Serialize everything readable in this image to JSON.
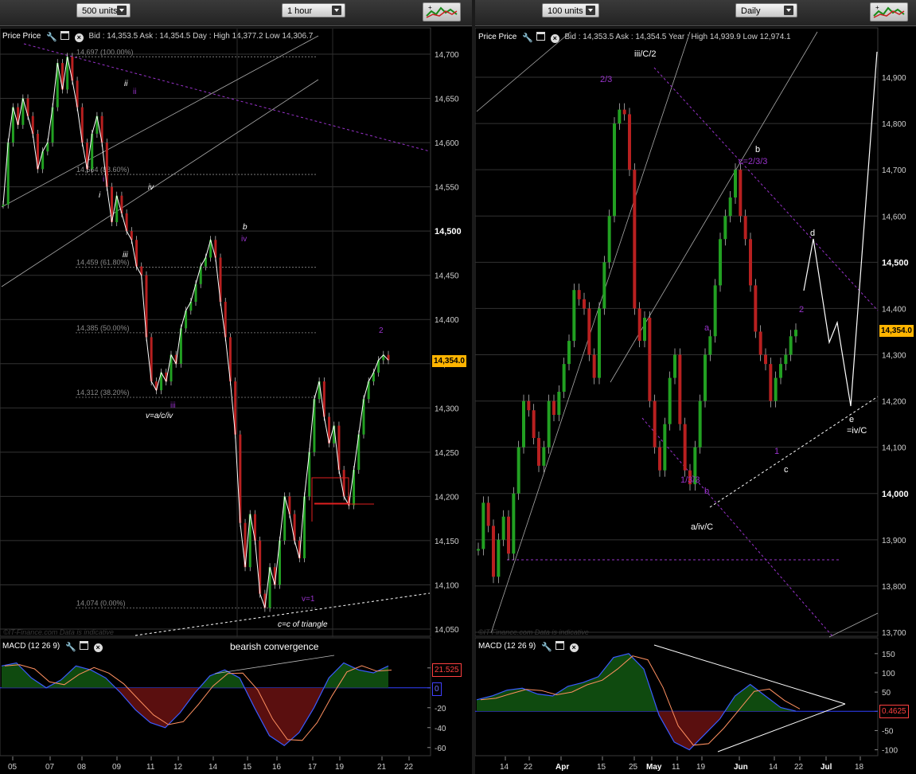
{
  "left": {
    "units_label": "500 units",
    "interval_label": "1 hour",
    "header": {
      "name": "Price Price",
      "quote": "Bid : 14,353.5  Ask : 14,354.5  Day : High 14,377.2  Low 14,306.7"
    },
    "price_tag": "14,354.0",
    "y_ticks": [
      "14,700",
      "14,650",
      "14,600",
      "14,550",
      "14,500",
      "14,450",
      "14,400",
      "14,350",
      "14,300",
      "14,250",
      "14,200",
      "14,150",
      "14,100",
      "14,050"
    ],
    "x_ticks": [
      "05",
      "07",
      "08",
      "09",
      "11",
      "12",
      "14",
      "15",
      "16",
      "17",
      "19",
      "21",
      "22"
    ],
    "fib_levels": [
      "14,697 (100.00%)",
      "14,564 (88.60%)",
      "14,459 (61.80%)",
      "14,385 (50.00%)",
      "14,312 (38.20%)",
      "14,074 (0.00%)"
    ],
    "wave_labels": {
      "ii_w": "ii",
      "ii_p": "ii",
      "i_p": "i",
      "i_w": "i",
      "iv_w": "iv",
      "iii_w": "iii",
      "iii_p": "iii",
      "v_acfv": "v=a/c/iv",
      "b": "b",
      "iv_p": "iv",
      "two": "2",
      "v1": "v=1",
      "c_tri": "c=c of triangle"
    },
    "watermark": "©IT-Finance.com  Data is indicative",
    "macd": {
      "title": "MACD (12 26 9)",
      "annotation": "bearish convergence",
      "value": "21.525",
      "zero_tag": "0",
      "ticks": [
        "20",
        "0",
        "-20",
        "-40",
        "-60"
      ]
    },
    "bold_tick": "14,500"
  },
  "right": {
    "units_label": "100 units",
    "interval_label": "Daily",
    "header": {
      "name": "Price Price",
      "quote": "Bid : 14,353.5  Ask : 14,354.5  Year : High 14,939.9  Low 12,974.1"
    },
    "price_tag": "14,354.0",
    "y_ticks": [
      "14,900",
      "14,800",
      "14,700",
      "14,600",
      "14,500",
      "14,400",
      "14,300",
      "14,200",
      "14,100",
      "14,000",
      "13,900",
      "13,800",
      "13,700"
    ],
    "x_ticks": [
      "14",
      "22",
      "Apr",
      "15",
      "25",
      "May",
      "11",
      "19",
      "Jun",
      "14",
      "22",
      "Jul",
      "18"
    ],
    "wave_labels": {
      "iiiC2": "iii/C/2",
      "two3": "2/3",
      "b": "b",
      "c23": "c=2/3/3",
      "a": "a",
      "one33": "1/3/3",
      "b2": "b",
      "aivC": "a/iv/C",
      "d": "d",
      "two": "2",
      "one": "1",
      "c": "c",
      "e": "e",
      "ivC": "=iv/C"
    },
    "watermark": "©IT-Finance.com  Data is indicative",
    "macd": {
      "title": "MACD (12 26 9)",
      "value": "0.4625",
      "ticks": [
        "150",
        "100",
        "50",
        "0",
        "-50",
        "-100"
      ]
    }
  },
  "colors": {
    "up": "#22a022",
    "down": "#b82020",
    "fib": "#8a8a8a",
    "purple": "#9933cc",
    "grid": "#333333",
    "macd_pos": "#0f4a0f",
    "macd_neg": "#5a0f0f",
    "price_tag": "#ffb400"
  },
  "chart_data": [
    {
      "type": "line",
      "title": "Price Price",
      "interval": "1 hour",
      "x_ticks": [
        "05",
        "07",
        "08",
        "09",
        "11",
        "12",
        "14",
        "15",
        "16",
        "17",
        "19",
        "21",
        "22"
      ],
      "ylim": [
        14050,
        14700
      ],
      "x": [
        0,
        1,
        2,
        3,
        4,
        5,
        6,
        7,
        8,
        9,
        10,
        11,
        12,
        13,
        14,
        15,
        16,
        17,
        18,
        19,
        20,
        21,
        22,
        23,
        24,
        25,
        26,
        27,
        28,
        29,
        30,
        31,
        32,
        33,
        34,
        35,
        36,
        37,
        38,
        39,
        40,
        41,
        42,
        43,
        44,
        45,
        46,
        47,
        48,
        49,
        50,
        51,
        52,
        53,
        54,
        55,
        56,
        57,
        58,
        59,
        60,
        61,
        62,
        63,
        64,
        65,
        66,
        67,
        68,
        69,
        70,
        71,
        72,
        73,
        74,
        75,
        76,
        77,
        78,
        79,
        80,
        81,
        82,
        83,
        84,
        85,
        86,
        87,
        88
      ],
      "series": [
        {
          "values": [
            14530,
            14600,
            14640,
            14620,
            14650,
            14630,
            14610,
            14570,
            14590,
            14600,
            14640,
            14690,
            14660,
            14697,
            14670,
            14640,
            14600,
            14570,
            14610,
            14630,
            14600,
            14550,
            14510,
            14540,
            14520,
            14500,
            14490,
            14460,
            14450,
            14380,
            14330,
            14320,
            14340,
            14330,
            14360,
            14350,
            14390,
            14410,
            14420,
            14440,
            14460,
            14470,
            14490,
            14470,
            14420,
            14380,
            14330,
            14270,
            14170,
            14120,
            14180,
            14150,
            14090,
            14074,
            14120,
            14100,
            14150,
            14200,
            14180,
            14150,
            14130,
            14200,
            14250,
            14310,
            14330,
            14290,
            14260,
            14280,
            14230,
            14200,
            14190,
            14230,
            14270,
            14310,
            14330,
            14340,
            14354,
            14360,
            14354
          ]
        }
      ],
      "fibonacci": [
        {
          "level": "100.00%",
          "value": 14697
        },
        {
          "level": "88.60%",
          "value": 14564
        },
        {
          "level": "61.80%",
          "value": 14459
        },
        {
          "level": "50.00%",
          "value": 14385
        },
        {
          "level": "38.20%",
          "value": 14312
        },
        {
          "level": "0.00%",
          "value": 14074
        }
      ],
      "last": 14354.0
    },
    {
      "type": "line",
      "title": "Price Price",
      "interval": "Daily",
      "x_ticks": [
        "14",
        "22",
        "Apr",
        "15",
        "25",
        "May",
        "11",
        "19",
        "Jun",
        "14",
        "22",
        "Jul",
        "18"
      ],
      "ylim": [
        13700,
        14950
      ],
      "x": [
        0,
        1,
        2,
        3,
        4,
        5,
        6,
        7,
        8,
        9,
        10,
        11,
        12,
        13,
        14,
        15,
        16,
        17,
        18,
        19,
        20,
        21,
        22,
        23,
        24,
        25,
        26,
        27,
        28,
        29,
        30,
        31,
        32,
        33,
        34,
        35,
        36,
        37,
        38,
        39,
        40,
        41,
        42,
        43,
        44,
        45,
        46,
        47,
        48,
        49,
        50,
        51,
        52,
        53,
        54,
        55,
        56,
        57,
        58,
        59,
        60,
        61,
        62,
        63,
        64,
        65,
        66,
        67,
        68,
        69,
        70
      ],
      "series": [
        {
          "values": [
            13880,
            13980,
            13930,
            13820,
            13900,
            13950,
            13870,
            14000,
            14100,
            14200,
            14180,
            14120,
            14060,
            14100,
            14200,
            14170,
            14220,
            14280,
            14330,
            14440,
            14420,
            14400,
            14300,
            14250,
            14400,
            14500,
            14600,
            14800,
            14830,
            14820,
            14700,
            14400,
            14330,
            14380,
            14200,
            14100,
            14050,
            14150,
            14250,
            14300,
            14150,
            14050,
            14020,
            14100,
            14200,
            14300,
            14340,
            14450,
            14550,
            14600,
            14640,
            14700,
            14600,
            14550,
            14450,
            14350,
            14300,
            14280,
            14200,
            14250,
            14280,
            14300,
            14340,
            14354
          ]
        }
      ],
      "projection": {
        "labels": [
          "d",
          "e"
        ],
        "values": [
          14550,
          14180,
          14950
        ]
      },
      "last": 14354.0
    },
    {
      "type": "area",
      "title": "MACD (12 26 9)",
      "panel": "left",
      "ylim": [
        -65,
        35
      ],
      "values": [
        22,
        25,
        10,
        0,
        8,
        22,
        18,
        10,
        -5,
        -22,
        -35,
        -40,
        -25,
        -5,
        12,
        18,
        10,
        -20,
        -48,
        -58,
        -45,
        -20,
        10,
        25,
        18,
        15,
        22
      ],
      "last": 21.525
    },
    {
      "type": "area",
      "title": "MACD (12 26 9)",
      "panel": "right",
      "ylim": [
        -105,
        160
      ],
      "values": [
        30,
        40,
        55,
        60,
        45,
        40,
        65,
        75,
        90,
        140,
        150,
        110,
        -10,
        -80,
        -100,
        -60,
        -20,
        40,
        70,
        40,
        10,
        0.4625
      ],
      "last": 0.4625
    }
  ]
}
